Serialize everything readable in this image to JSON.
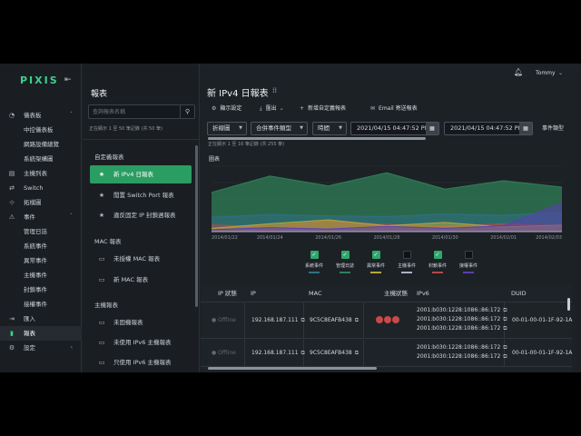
{
  "brand": {
    "logo": "PIXIS"
  },
  "nav": {
    "items": [
      {
        "label": "儀表板",
        "icon": "gauge-icon",
        "chevron": "ˆ"
      },
      {
        "label": "中控儀表板",
        "sub": true
      },
      {
        "label": "網路設備總覽",
        "sub": true
      },
      {
        "label": "系統架構圖",
        "sub": true
      },
      {
        "label": "主機列表",
        "icon": "server-icon"
      },
      {
        "label": "Switch",
        "icon": "switch-icon"
      },
      {
        "label": "拓樸圖",
        "icon": "topology-icon"
      },
      {
        "label": "事件",
        "icon": "event-icon",
        "chevron": "ˆ"
      },
      {
        "label": "管理日誌",
        "sub": true
      },
      {
        "label": "系統事件",
        "sub": true
      },
      {
        "label": "異常事件",
        "sub": true
      },
      {
        "label": "主機事件",
        "sub": true
      },
      {
        "label": "封鎖事件",
        "sub": true
      },
      {
        "label": "接權事件",
        "sub": true
      },
      {
        "label": "匯入",
        "icon": "import-icon"
      },
      {
        "label": "報表",
        "icon": "report-icon",
        "active": true
      },
      {
        "label": "設定",
        "icon": "settings-icon",
        "chevron": "‹"
      }
    ]
  },
  "panel": {
    "title": "報表",
    "search_placeholder": "查詢報表名稱",
    "count": "正在顯示 1 至 50 筆記錄 (共 50 筆)",
    "groups": [
      {
        "label": "自定義報表"
      },
      {
        "label": "MAC 報表"
      },
      {
        "label": "主機報表"
      }
    ],
    "items": [
      {
        "label": "新 IPv4 日報表",
        "icon": "★",
        "active": true
      },
      {
        "label": "閒置 Switch Port 報表",
        "icon": "★"
      },
      {
        "label": "違反固定 IP 封鎖週報表",
        "icon": "★"
      },
      {
        "label": "未授權 MAC 報表",
        "icon": "▭"
      },
      {
        "label": "新 MAC 報表",
        "icon": "▭"
      },
      {
        "label": "未固機報表",
        "icon": "▭"
      },
      {
        "label": "未使用 IPv6 主機報表",
        "icon": "▭"
      },
      {
        "label": "只使用 IPv6 主機報表",
        "icon": "▭"
      }
    ]
  },
  "header": {
    "user": "Tommy"
  },
  "main": {
    "title": "新 IPv4 日報表",
    "toolbar": {
      "settings": "顯示設定",
      "export": "匯出",
      "add_custom": "新增自定義報表",
      "email": "Email 寄送報表"
    },
    "filters": {
      "chart_type": "折線圖",
      "event_type": "合併事件類型",
      "time": "時間",
      "start": "2021/04/15 04:47:52 PM",
      "end": "2021/04/15 04:47:52 PM",
      "event_filter": "事件類型"
    },
    "result_count": "正在顯示 1 至 16 筆記錄 (共 255 筆)",
    "chart_tag": "圖表"
  },
  "chart_data": {
    "type": "area",
    "x": [
      "2014/01/22",
      "2014/01/24",
      "2014/01/26",
      "2014/01/28",
      "2014/01/30",
      "2014/02/01",
      "2014/02/03"
    ],
    "series": [
      {
        "name": "系統事件",
        "color": "#2f6f86",
        "values": [
          22,
          26,
          24,
          23,
          27,
          25,
          29
        ]
      },
      {
        "name": "管理日誌",
        "color": "#2f7f57",
        "values": [
          60,
          85,
          70,
          90,
          65,
          78,
          68
        ]
      },
      {
        "name": "異常事件",
        "color": "#b9a53a",
        "values": [
          5,
          12,
          18,
          9,
          14,
          7,
          10
        ]
      },
      {
        "name": "主機事件",
        "color": "#b0b0c8",
        "values": [
          0,
          0,
          0,
          0,
          0,
          0,
          0
        ]
      },
      {
        "name": "封鎖事件",
        "color": "#b14a4a",
        "values": [
          10,
          8,
          16,
          11,
          8,
          12,
          9
        ]
      },
      {
        "name": "接權事件",
        "color": "#5a3fb0",
        "values": [
          3,
          6,
          4,
          8,
          5,
          9,
          44
        ]
      }
    ],
    "legend_enabled": [
      true,
      true,
      true,
      false,
      true,
      false
    ],
    "ylim": [
      0,
      100
    ],
    "grid": true,
    "legend_position": "bottom"
  },
  "table": {
    "columns": [
      "IP 狀態",
      "IP",
      "MAC",
      "主機狀態",
      "IPv6",
      "DUID"
    ],
    "rows": [
      {
        "status": "Offline",
        "ip": "192.168.187.111",
        "mac": "9C5C8EAFB438",
        "ipv6": [
          "2001:b030:1228:1086::86:172",
          "2001:b030:1228:1086::86:172",
          "2001:b030:1228:1086::86:172"
        ],
        "duid": "00-01-00-01-1F-92-1A"
      },
      {
        "status": "Offline",
        "ip": "192.168.187.111",
        "mac": "9C5C8EAFB438",
        "ipv6": [
          "2001:b030:1228:1086::86:172",
          "2001:b030:1228:1086::86:172"
        ],
        "duid": "00-01-00-01-1F-92-1A"
      }
    ]
  }
}
